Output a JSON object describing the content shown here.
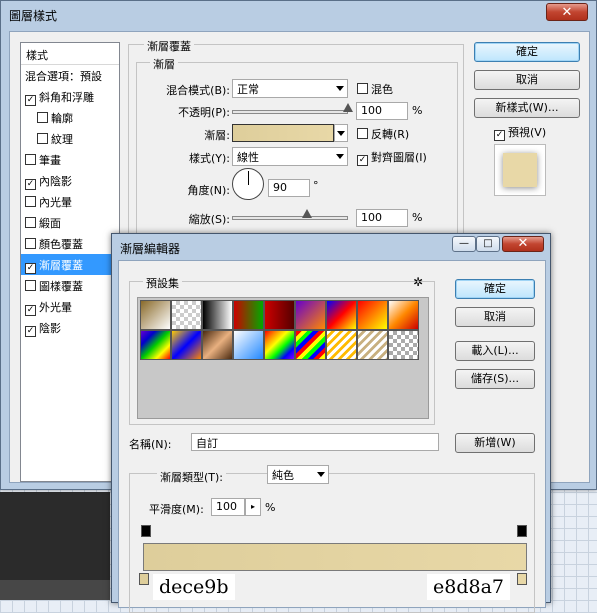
{
  "main": {
    "title": "圖層樣式",
    "close": "✕",
    "style_list": {
      "header": "樣式",
      "items": [
        {
          "label": "混合選項：預設",
          "checkbox": false,
          "checked": false,
          "indent": false,
          "selected": false
        },
        {
          "label": "斜角和浮雕",
          "checkbox": true,
          "checked": true,
          "indent": false,
          "selected": false
        },
        {
          "label": "輪廓",
          "checkbox": true,
          "checked": false,
          "indent": true,
          "selected": false
        },
        {
          "label": "紋理",
          "checkbox": true,
          "checked": false,
          "indent": true,
          "selected": false
        },
        {
          "label": "筆畫",
          "checkbox": true,
          "checked": false,
          "indent": false,
          "selected": false
        },
        {
          "label": "內陰影",
          "checkbox": true,
          "checked": true,
          "indent": false,
          "selected": false
        },
        {
          "label": "內光暈",
          "checkbox": true,
          "checked": false,
          "indent": false,
          "selected": false
        },
        {
          "label": "緞面",
          "checkbox": true,
          "checked": false,
          "indent": false,
          "selected": false
        },
        {
          "label": "顏色覆蓋",
          "checkbox": true,
          "checked": false,
          "indent": false,
          "selected": false
        },
        {
          "label": "漸層覆蓋",
          "checkbox": true,
          "checked": true,
          "indent": false,
          "selected": true
        },
        {
          "label": "圖樣覆蓋",
          "checkbox": true,
          "checked": false,
          "indent": false,
          "selected": false
        },
        {
          "label": "外光暈",
          "checkbox": true,
          "checked": true,
          "indent": false,
          "selected": false
        },
        {
          "label": "陰影",
          "checkbox": true,
          "checked": true,
          "indent": false,
          "selected": false
        }
      ]
    },
    "overlay": {
      "group_title": "漸層覆蓋",
      "sub_title": "漸層",
      "blend_mode_label": "混合模式(B):",
      "blend_mode_value": "正常",
      "dither_label": "混色",
      "opacity_label": "不透明(P):",
      "opacity_value": "100",
      "opacity_pct": 100,
      "percent": "%",
      "gradient_label": "漸層:",
      "reverse_label": "反轉(R)",
      "style_label": "樣式(Y):",
      "style_value": "線性",
      "align_label": "對齊圖層(I)",
      "angle_label": "角度(N):",
      "angle_value": "90",
      "degree": "°",
      "scale_label": "縮放(S):",
      "scale_value": "100",
      "scale_pct": 100
    },
    "buttons": {
      "ok": "確定",
      "cancel": "取消",
      "new_style": "新樣式(W)...",
      "preview": "預視(V)"
    }
  },
  "editor": {
    "title": "漸層編輯器",
    "presets_label": "預設集",
    "gear": "✲",
    "ok": "確定",
    "cancel": "取消",
    "load": "載入(L)...",
    "save": "儲存(S)...",
    "name_label": "名稱(N):",
    "name_value": "自訂",
    "new_button": "新增(W)",
    "type_label": "漸層類型(T):",
    "type_value": "純色",
    "smooth_label": "平滑度(M):",
    "smooth_value": "100",
    "percent": "%",
    "stop_left_hex": "dece9b",
    "stop_right_hex": "e8d8a7"
  },
  "colors": {
    "gradient_start": "#dece9b",
    "gradient_end": "#e8d8a7",
    "selection": "#3399ff"
  }
}
